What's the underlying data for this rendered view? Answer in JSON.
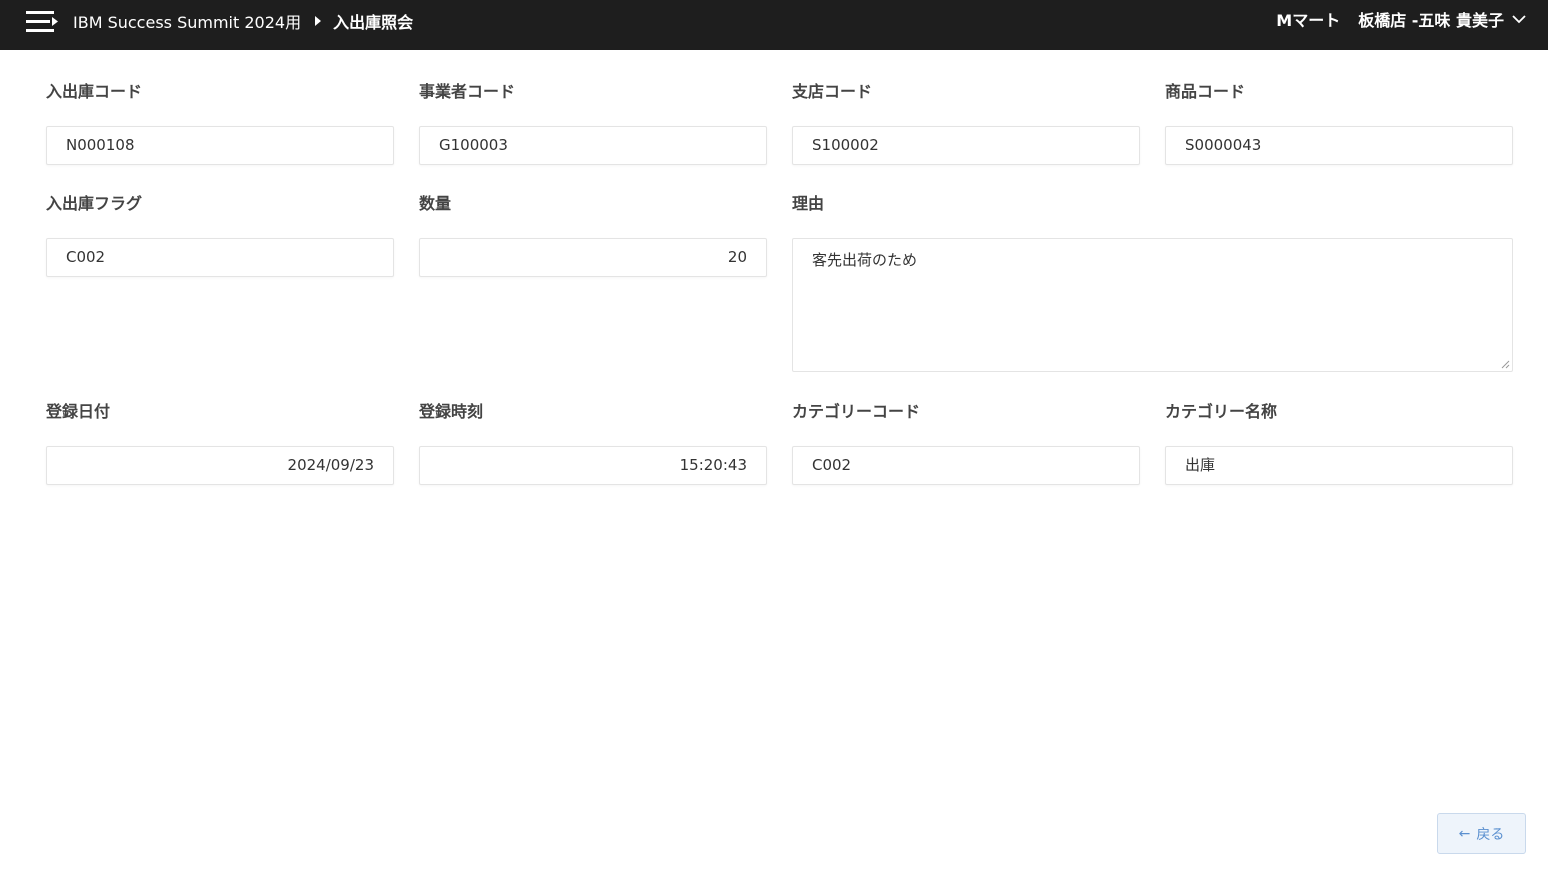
{
  "header": {
    "app_name": "IBM Success Summit 2024用",
    "current_page": "入出庫照会",
    "store": "Mマート",
    "user": "板橋店 -五味 貴美子"
  },
  "form": {
    "nyushukko_code": {
      "label": "入出庫コード",
      "value": "N000108"
    },
    "jigyosha_code": {
      "label": "事業者コード",
      "value": "G100003"
    },
    "shiten_code": {
      "label": "支店コード",
      "value": "S100002"
    },
    "shohin_code": {
      "label": "商品コード",
      "value": "S0000043"
    },
    "nyushukko_flag": {
      "label": "入出庫フラグ",
      "value": "C002"
    },
    "suryo": {
      "label": "数量",
      "value": "20"
    },
    "riyu": {
      "label": "理由",
      "value": "客先出荷のため"
    },
    "toroku_hizuke": {
      "label": "登録日付",
      "value": "2024/09/23"
    },
    "toroku_jikoku": {
      "label": "登録時刻",
      "value": "15:20:43"
    },
    "category_code": {
      "label": "カテゴリーコード",
      "value": "C002"
    },
    "category_name": {
      "label": "カテゴリー名称",
      "value": "出庫"
    }
  },
  "footer": {
    "back_label": "戻る"
  },
  "colors": {
    "header_bg": "#1e1e1e",
    "accent": "#5a8fcf"
  },
  "icons": {
    "menu": "hamburger-menu-icon",
    "breadcrumb_separator": "caret-right-icon",
    "user_dropdown": "chevron-down-icon",
    "back": "arrow-left-icon"
  }
}
